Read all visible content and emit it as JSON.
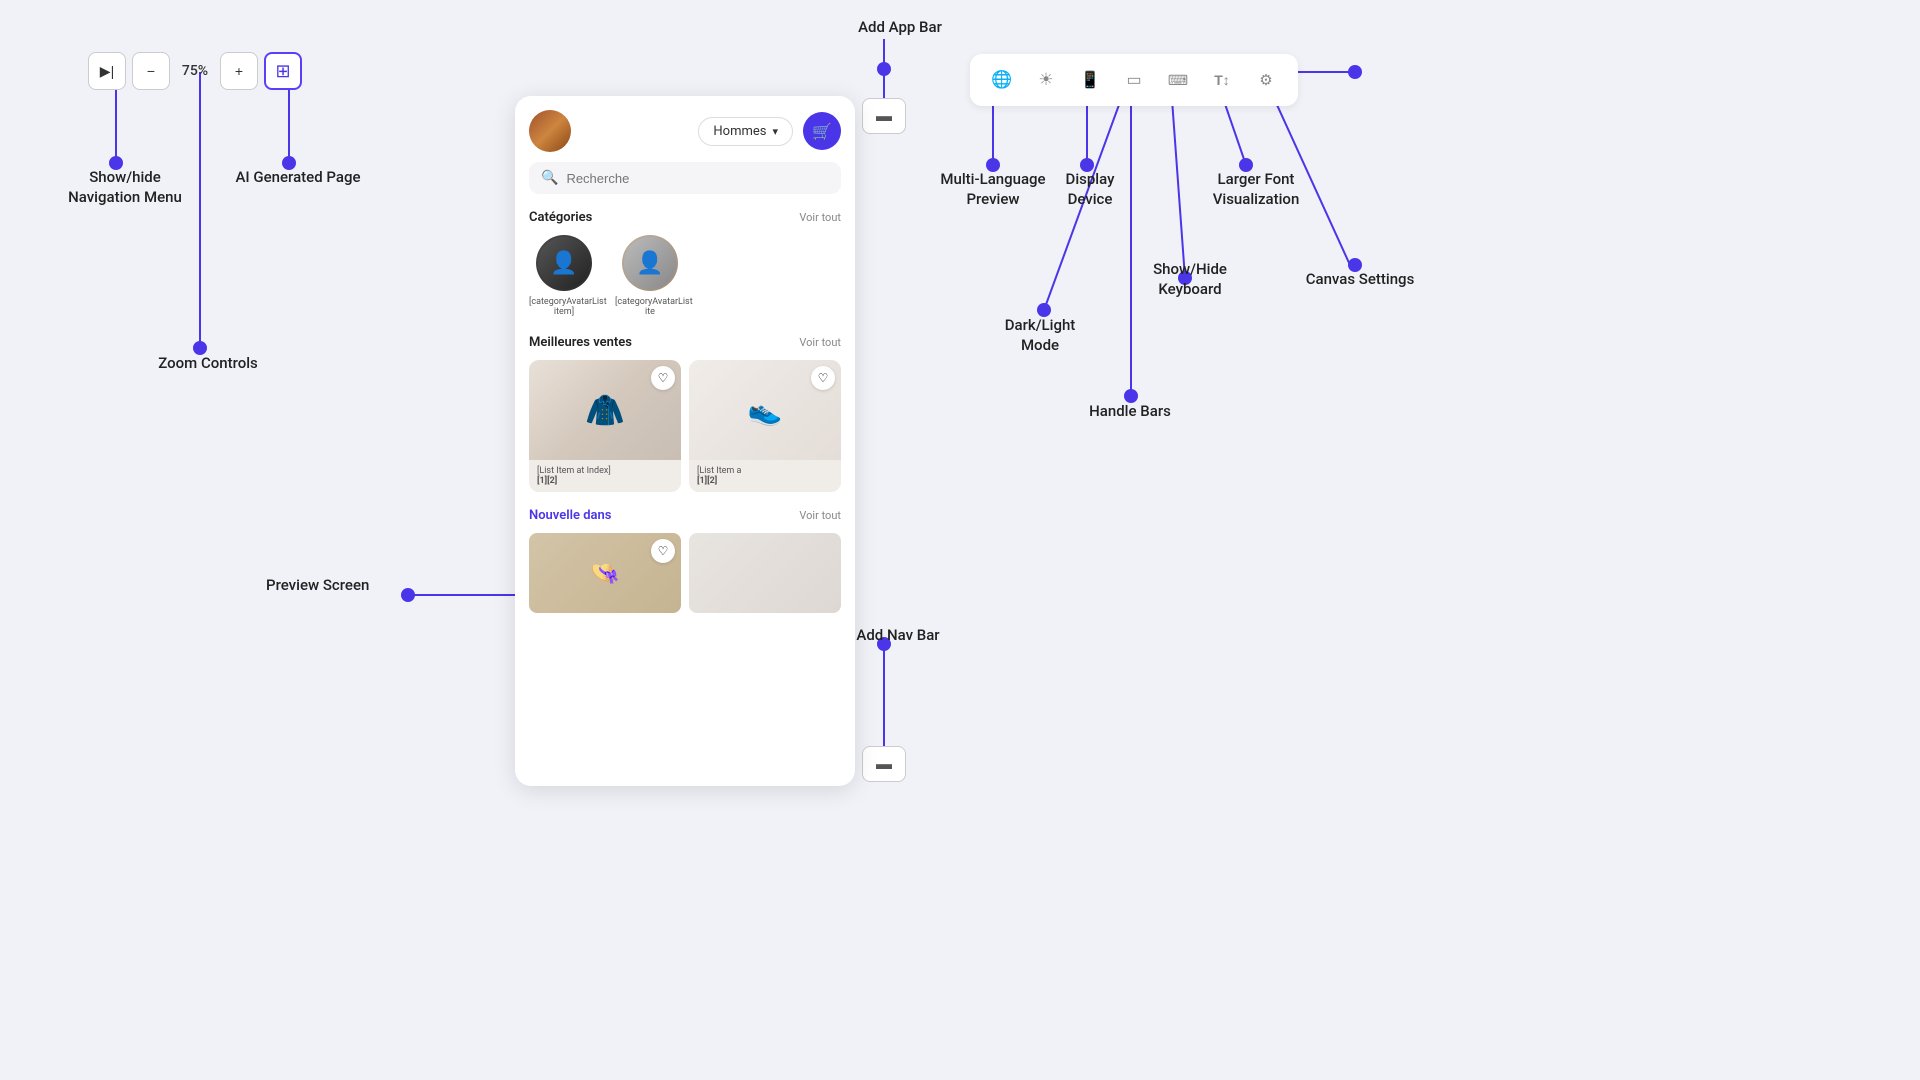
{
  "toolbar": {
    "hide_nav_label": ">|",
    "zoom_minus": "−",
    "zoom_value": "75%",
    "zoom_plus": "+",
    "ai_icon": "⊞"
  },
  "labels": {
    "show_hide_nav": "Show/hide\nNavigation Menu",
    "ai_generated": "AI Generated Page",
    "zoom_controls": "Zoom Controls",
    "preview_screen": "Preview Screen",
    "add_app_bar": "Add App Bar",
    "multi_language": "Multi-Language\nPreview",
    "display_device": "Display\nDevice",
    "dark_light": "Dark/Light\nMode",
    "handle_bars": "Handle Bars",
    "show_hide_keyboard": "Show/Hide\nKeyboard",
    "larger_font": "Larger Font\nVisualization",
    "canvas_settings": "Canvas Settings",
    "add_nav_bar": "Add Nav Bar"
  },
  "mobile": {
    "category_dropdown": "Hommes",
    "search_placeholder": "Recherche",
    "categories_title": "Catégories",
    "voir_tout_1": "Voir tout",
    "cat1_label": "[categoryAvatarList item]",
    "cat2_label": "[categoryAvatarList ite",
    "meilleures_title": "Meilleures ventes",
    "voir_tout_2": "Voir tout",
    "product1_name": "[List Item at Index]\n[1][2]",
    "product2_name": "[List Item a\n[1][2]",
    "nouvelle_label": "Nouvelle dans",
    "voir_tout_3": "Voir tout"
  },
  "right_toolbar": {
    "globe_icon": "🌐",
    "sun_icon": "☀",
    "phone_icon": "📱",
    "tablet_icon": "⊟",
    "keyboard_icon": "⌨",
    "font_icon": "T↕",
    "settings_icon": "⚙"
  },
  "colors": {
    "accent": "#4a35e8",
    "dot": "#4a35e8",
    "background": "#f0f2f8",
    "line": "#4a35e8"
  }
}
